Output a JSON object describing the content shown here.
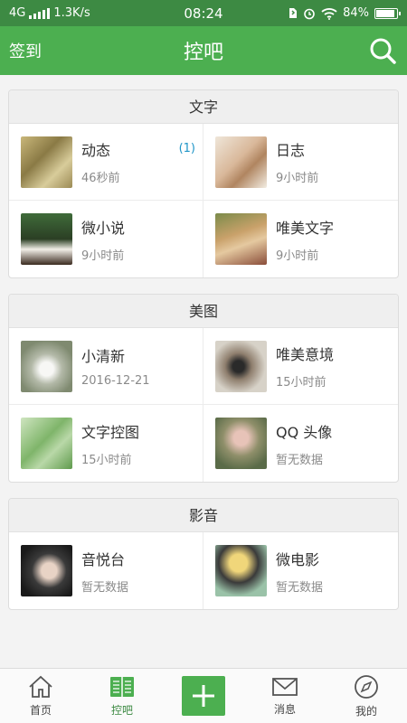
{
  "status_bar": {
    "network": "4G",
    "speed": "1.3K/s",
    "time": "08:24",
    "battery_text": "84%",
    "battery_level": 0.84
  },
  "header": {
    "left_label": "签到",
    "title": "控吧",
    "search_icon": "search-icon"
  },
  "sections": [
    {
      "title": "文字",
      "items": [
        {
          "name": "动态",
          "time": "46秒前",
          "badge": "(1)"
        },
        {
          "name": "日志",
          "time": "9小时前"
        },
        {
          "name": "微小说",
          "time": "9小时前"
        },
        {
          "name": "唯美文字",
          "time": "9小时前"
        }
      ]
    },
    {
      "title": "美图",
      "items": [
        {
          "name": "小清新",
          "time": "2016-12-21"
        },
        {
          "name": "唯美意境",
          "time": "15小时前"
        },
        {
          "name": "文字控图",
          "time": "15小时前"
        },
        {
          "name": "QQ 头像",
          "time": "暂无数据"
        }
      ]
    },
    {
      "title": "影音",
      "items": [
        {
          "name": "音悦台",
          "time": "暂无数据"
        },
        {
          "name": "微电影",
          "time": "暂无数据"
        }
      ]
    }
  ],
  "bottom_nav": {
    "home": "首页",
    "kongba": "控吧",
    "messages": "消息",
    "mine": "我的"
  },
  "colors": {
    "primary": "#4caf50",
    "status_bar": "#3d8a43",
    "badge": "#2196c8"
  }
}
